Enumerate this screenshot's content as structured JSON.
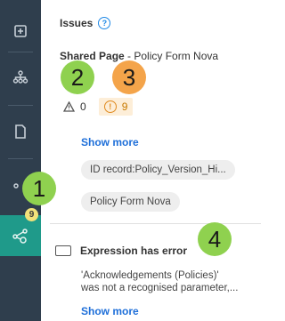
{
  "sidebar": {
    "items": [
      {
        "icon": "add-square-icon"
      },
      {
        "icon": "hierarchy-icon"
      },
      {
        "icon": "page-icon"
      },
      {
        "icon": "connector-icon"
      },
      {
        "icon": "issues-icon",
        "active": true,
        "badge": "9"
      }
    ]
  },
  "panel": {
    "title": "Issues",
    "help_glyph": "?",
    "shared_prefix": "Shared Page",
    "shared_name": " - Policy Form Nova",
    "counts": {
      "warnings": "0",
      "errors": "9"
    },
    "show_more_1": "Show more",
    "chips": [
      "ID record:Policy_Version_Hi...",
      "Policy Form Nova"
    ],
    "issue": {
      "title": "Expression has error",
      "description_lines": [
        "'Acknowledgements (Policies)'",
        "was not a recognised parameter,..."
      ],
      "show_more": "Show more"
    }
  },
  "callouts": [
    "1",
    "2",
    "3",
    "4"
  ],
  "colors": {
    "sidebar_bg": "#2f3e4d",
    "active_bg": "#1f9a8a",
    "badge_bg": "#f2e27a",
    "link": "#1e6fd9",
    "error_bg": "#fdeed8",
    "error_fg": "#c77a00",
    "callout_green": "#8fd14f",
    "callout_orange": "#f4a44a"
  }
}
